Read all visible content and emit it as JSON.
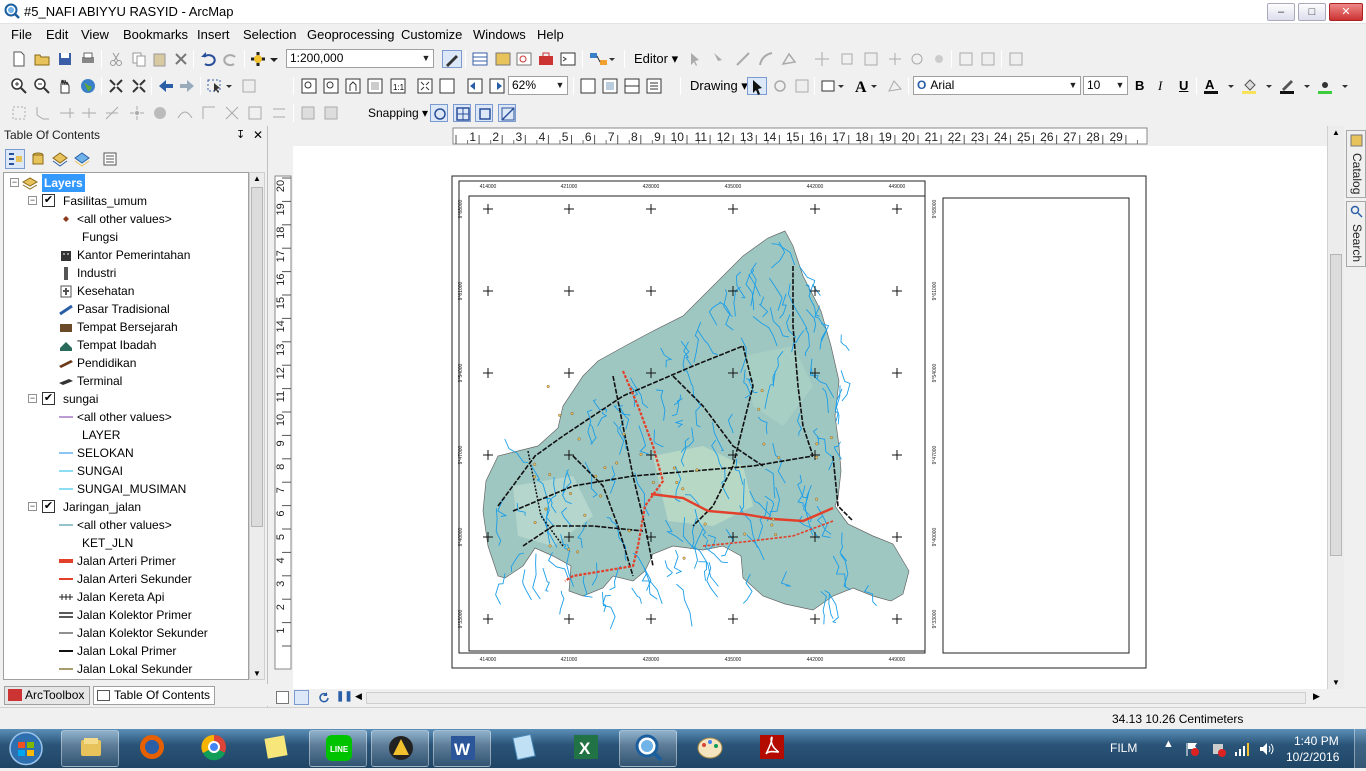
{
  "window": {
    "title": "#5_NAFI ABIYYU RASYID - ArcMap",
    "min": "–",
    "max": "□",
    "close": "✕"
  },
  "menu": [
    "File",
    "Edit",
    "View",
    "Bookmarks",
    "Insert",
    "Selection",
    "Geoprocessing",
    "Customize",
    "Windows",
    "Help"
  ],
  "toolbar": {
    "scale": "1:200,000",
    "editor": "Editor ▾",
    "zoom": "62%",
    "drawing": "Drawing ▾",
    "font": "Arial",
    "font_size": "10",
    "bold": "B",
    "italic": "I",
    "underline": "U",
    "snapping": "Snapping ▾",
    "text_tool": "A"
  },
  "toc": {
    "title": "Table Of Contents",
    "pin": "↧",
    "close": "✕",
    "rows": [
      {
        "level": 0,
        "label": "Layers",
        "expand": "−",
        "check": false,
        "selected": true,
        "sym": "layers-icon"
      },
      {
        "level": 1,
        "label": "Fasilitas_umum",
        "expand": "−",
        "check": true
      },
      {
        "level": 2,
        "label": "<all other values>",
        "sym": "point-symbol"
      },
      {
        "level": 3,
        "label": "Fungsi"
      },
      {
        "level": 2,
        "label": "Kantor Pemerintahan",
        "sym": "building-icon"
      },
      {
        "level": 2,
        "label": "Industri",
        "sym": "factory-icon"
      },
      {
        "level": 2,
        "label": "Kesehatan",
        "sym": "hospital-icon"
      },
      {
        "level": 2,
        "label": "Pasar Tradisional",
        "sym": "market-icon"
      },
      {
        "level": 2,
        "label": "Tempat Bersejarah",
        "sym": "monument-icon"
      },
      {
        "level": 2,
        "label": "Tempat Ibadah",
        "sym": "worship-icon"
      },
      {
        "level": 2,
        "label": "Pendidikan",
        "sym": "school-icon"
      },
      {
        "level": 2,
        "label": "Terminal",
        "sym": "bus-icon"
      },
      {
        "level": 1,
        "label": "sungai",
        "expand": "−",
        "check": true
      },
      {
        "level": 2,
        "label": "<all other values>",
        "sym": "line-purple"
      },
      {
        "level": 3,
        "label": "LAYER"
      },
      {
        "level": 2,
        "label": "SELOKAN",
        "sym": "line-blue"
      },
      {
        "level": 2,
        "label": "SUNGAI",
        "sym": "line-cyan"
      },
      {
        "level": 2,
        "label": "SUNGAI_MUSIMAN",
        "sym": "line-cyan"
      },
      {
        "level": 1,
        "label": "Jaringan_jalan",
        "expand": "−",
        "check": true
      },
      {
        "level": 2,
        "label": "<all other values>",
        "sym": "line-teal"
      },
      {
        "level": 3,
        "label": "KET_JLN"
      },
      {
        "level": 2,
        "label": "Jalan Arteri Primer",
        "sym": "line-red-thick"
      },
      {
        "level": 2,
        "label": "Jalan Arteri Sekunder",
        "sym": "line-red"
      },
      {
        "level": 2,
        "label": "Jalan Kereta Api",
        "sym": "line-rail"
      },
      {
        "level": 2,
        "label": "Jalan Kolektor Primer",
        "sym": "line-double"
      },
      {
        "level": 2,
        "label": "Jalan Kolektor Sekunder",
        "sym": "line-black-thin"
      },
      {
        "level": 2,
        "label": "Jalan Lokal Primer",
        "sym": "line-black"
      },
      {
        "level": 2,
        "label": "Jalan Lokal Sekunder",
        "sym": "line-olive"
      }
    ],
    "tab_arctoolbox": "ArcToolbox",
    "tab_toc": "Table Of Contents"
  },
  "ruler": {
    "h": [
      "1",
      "2",
      "3",
      "4",
      "5",
      "6",
      "7",
      "8",
      "9",
      "10",
      "11",
      "12",
      "13",
      "14",
      "15",
      "16",
      "17",
      "18",
      "19",
      "20",
      "21",
      "22",
      "23",
      "24",
      "25",
      "26",
      "27",
      "28",
      "29"
    ],
    "v": [
      "20",
      "19",
      "18",
      "17",
      "16",
      "15",
      "14",
      "13",
      "12",
      "11",
      "10",
      "9",
      "8",
      "7",
      "6",
      "5",
      "4",
      "3",
      "2",
      "1"
    ]
  },
  "map": {
    "x_ticks": [
      "414000",
      "421000",
      "428000",
      "435000",
      "442000",
      "449000"
    ],
    "y_ticks": [
      "9°68000",
      "9°61000",
      "9°54000",
      "9°47000",
      "9°40000",
      "9°33000"
    ]
  },
  "sidebar": {
    "catalog": "Catalog",
    "search": "Search"
  },
  "status": {
    "coords": "34.13  10.26 Centimeters"
  },
  "taskbar": {
    "apps": [
      "explorer-icon",
      "firefox-icon",
      "chrome-icon",
      "sticky-notes-icon",
      "line-app-icon",
      "arcgis-icon",
      "word-icon",
      "notepad-icon",
      "excel-icon",
      "arcmap-icon",
      "paint-icon",
      "acrobat-icon"
    ],
    "lang": "FILM",
    "time": "1:40 PM",
    "date": "10/2/2016"
  },
  "colors": {
    "selection": "#3399ff",
    "water": "#1a9ee8",
    "land": "#9fc7c2",
    "road_red": "#e2402a"
  }
}
